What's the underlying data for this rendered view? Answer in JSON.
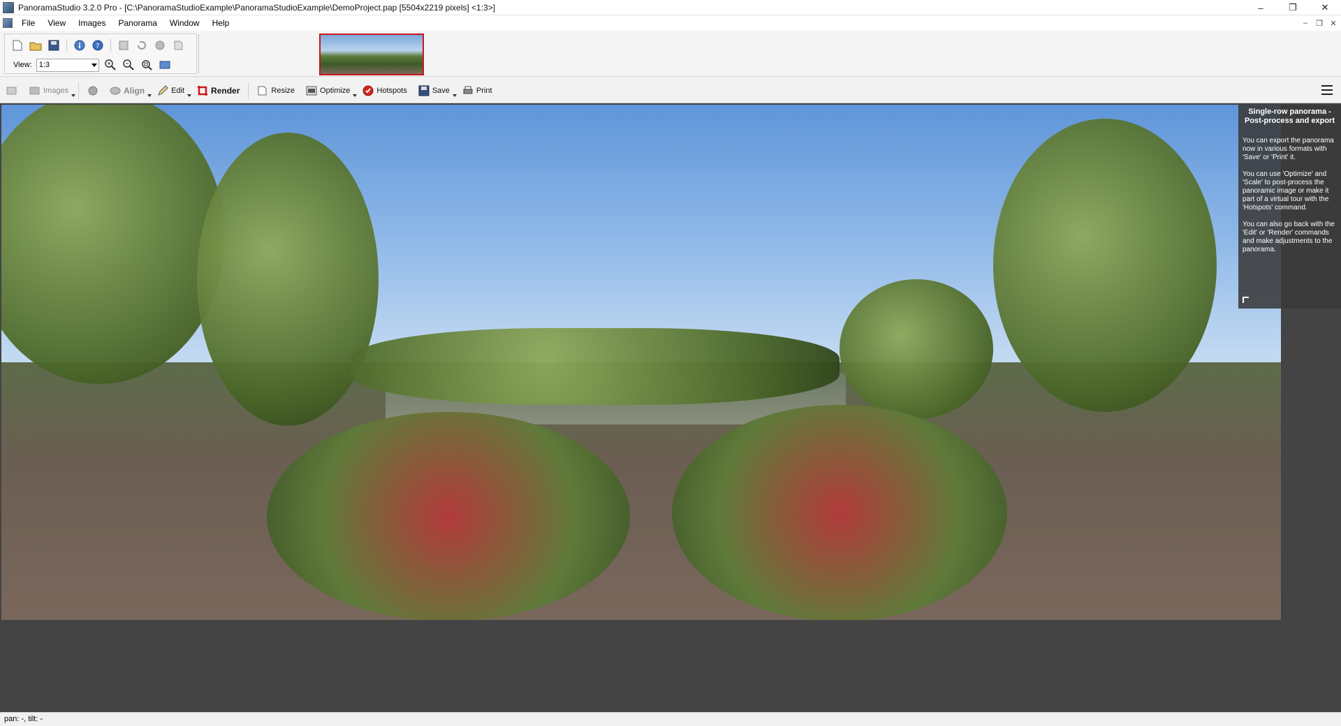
{
  "window": {
    "title": "PanoramaStudio 3.2.0 Pro - [C:\\PanoramaStudioExample\\PanoramaStudioExample\\DemoProject.pap [5504x2219 pixels] <1:3>]",
    "minimize": "–",
    "restore": "❐",
    "close": "✕"
  },
  "menu": {
    "items": [
      "File",
      "View",
      "Images",
      "Panorama",
      "Window",
      "Help"
    ],
    "mdi_minimize": "–",
    "mdi_restore": "❐",
    "mdi_close": "✕"
  },
  "view_toolbar": {
    "label": "View:",
    "value": "1:3"
  },
  "main_toolbar": {
    "images": "Images",
    "align": "Align",
    "edit": "Edit",
    "render": "Render",
    "resize": "Resize",
    "optimize": "Optimize",
    "hotspots": "Hotspots",
    "save": "Save",
    "print": "Print"
  },
  "info_panel": {
    "title": "Single-row panorama - Post-process and export",
    "p1": "You can export the panorama now in various formats with 'Save' or 'Print' it.",
    "p2": "You can use 'Optimize' and 'Scale' to post-process the panoramic image or make it part of a virtual tour with the 'Hotspots' command.",
    "p3": "You can also go back with the 'Edit' or 'Render' commands and make adjustments to the panorama."
  },
  "status": {
    "text": "pan: -, tilt: -"
  },
  "colors": {
    "canvas_bg": "#444444",
    "thumb_border": "#c8171c",
    "render_icon": "#c8171c",
    "hotspots_icon": "#d0261f"
  }
}
